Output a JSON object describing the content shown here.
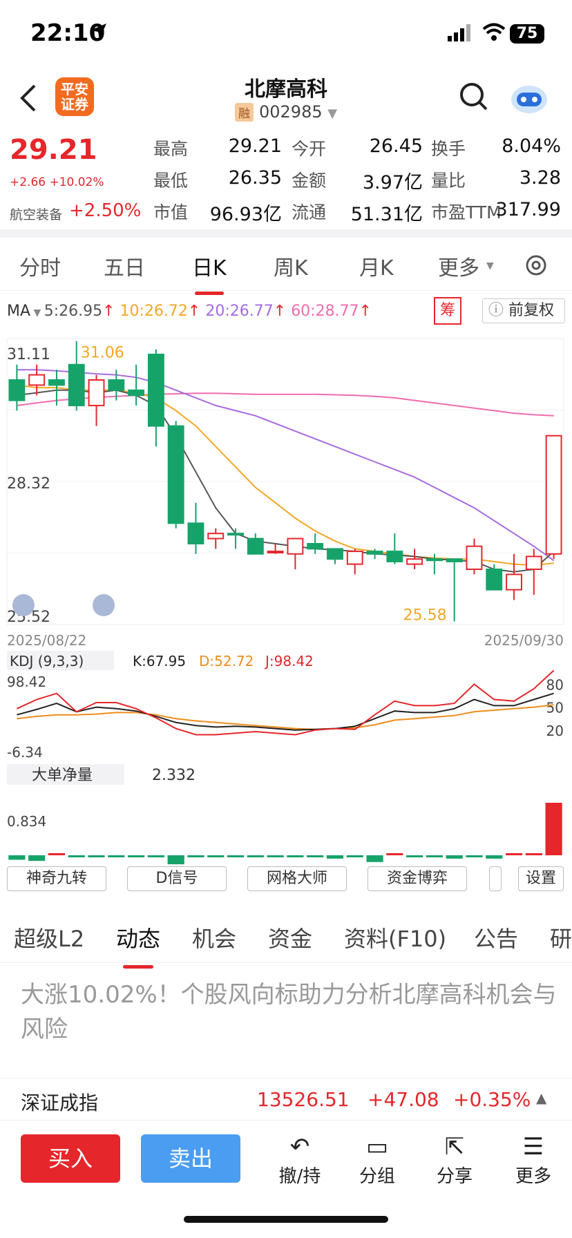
{
  "status": {
    "time": "22:10",
    "battery": "75"
  },
  "header": {
    "name": "北摩高科",
    "code": "002985",
    "rong": "融",
    "logo": "平安\n证券"
  },
  "quote": {
    "price": "29.21",
    "change": "+2.66 +10.02%",
    "sector": "航空装备",
    "sector_change": "+2.50%",
    "items": [
      {
        "label": "最高",
        "value": "29.21",
        "color": "red"
      },
      {
        "label": "今开",
        "value": "26.45",
        "color": "green"
      },
      {
        "label": "换手",
        "value": "8.04%",
        "color": "black"
      },
      {
        "label": "最低",
        "value": "26.35",
        "color": "green"
      },
      {
        "label": "金额",
        "value": "3.97亿",
        "color": "black"
      },
      {
        "label": "量比",
        "value": "3.28",
        "color": "black"
      },
      {
        "label": "市值",
        "value": "96.93亿",
        "color": "black"
      },
      {
        "label": "流通",
        "value": "51.31亿",
        "color": "black"
      },
      {
        "label": "市盈TTM",
        "value": "317.99",
        "color": "black"
      }
    ]
  },
  "periods": [
    "分时",
    "五日",
    "日K",
    "周K",
    "月K",
    "更多"
  ],
  "active_period": "日K",
  "ma": {
    "label": "MA",
    "ma5": "5:26.95",
    "ma10": "10:26.72",
    "ma20": "20:26.77",
    "ma60": "60:28.77",
    "chou": "筹",
    "fq": "前复权"
  },
  "chart_data": {
    "type": "candlestick",
    "y_max_label": "31.11",
    "y_mid_label": "28.32",
    "y_min_label": "25.52",
    "high_label": "31.06",
    "low_label": "25.58",
    "start_date": "2025/08/22",
    "end_date": "2025/09/30",
    "candles": [
      {
        "o": 30.3,
        "c": 29.9,
        "h": 30.6,
        "l": 29.7
      },
      {
        "o": 30.2,
        "c": 30.4,
        "h": 30.6,
        "l": 30.0
      },
      {
        "o": 30.3,
        "c": 30.2,
        "h": 30.5,
        "l": 29.8
      },
      {
        "o": 30.6,
        "c": 29.8,
        "h": 31.06,
        "l": 29.7
      },
      {
        "o": 29.8,
        "c": 30.3,
        "h": 30.4,
        "l": 29.4
      },
      {
        "o": 30.3,
        "c": 30.1,
        "h": 30.5,
        "l": 29.9
      },
      {
        "o": 30.1,
        "c": 30.0,
        "h": 30.6,
        "l": 29.8
      },
      {
        "o": 30.8,
        "c": 29.4,
        "h": 30.9,
        "l": 29.0
      },
      {
        "o": 29.4,
        "c": 27.5,
        "h": 29.5,
        "l": 27.4
      },
      {
        "o": 27.5,
        "c": 27.1,
        "h": 27.9,
        "l": 26.9
      },
      {
        "o": 27.2,
        "c": 27.3,
        "h": 27.4,
        "l": 27.0
      },
      {
        "o": 27.3,
        "c": 27.28,
        "h": 27.4,
        "l": 27.0
      },
      {
        "o": 27.2,
        "c": 26.9,
        "h": 27.3,
        "l": 26.9
      },
      {
        "o": 26.95,
        "c": 26.95,
        "h": 27.1,
        "l": 26.9
      },
      {
        "o": 26.9,
        "c": 27.2,
        "h": 27.2,
        "l": 26.6
      },
      {
        "o": 27.1,
        "c": 27.0,
        "h": 27.3,
        "l": 26.9
      },
      {
        "o": 27.0,
        "c": 26.8,
        "h": 27.0,
        "l": 26.7
      },
      {
        "o": 26.7,
        "c": 26.95,
        "h": 27.0,
        "l": 26.5
      },
      {
        "o": 26.95,
        "c": 26.9,
        "h": 27.0,
        "l": 26.8
      },
      {
        "o": 26.95,
        "c": 26.75,
        "h": 27.3,
        "l": 26.7
      },
      {
        "o": 26.7,
        "c": 26.8,
        "h": 27.0,
        "l": 26.6
      },
      {
        "o": 26.8,
        "c": 26.78,
        "h": 26.9,
        "l": 26.5
      },
      {
        "o": 26.8,
        "c": 26.75,
        "h": 26.8,
        "l": 25.58
      },
      {
        "o": 26.6,
        "c": 27.05,
        "h": 27.2,
        "l": 26.5
      },
      {
        "o": 26.6,
        "c": 26.2,
        "h": 26.7,
        "l": 26.2
      },
      {
        "o": 26.2,
        "c": 26.5,
        "h": 26.9,
        "l": 26.0
      },
      {
        "o": 26.6,
        "c": 26.85,
        "h": 27.0,
        "l": 26.1
      },
      {
        "o": 26.9,
        "c": 29.21,
        "h": 29.21,
        "l": 26.8
      }
    ],
    "ma5": [
      30.0,
      30.05,
      30.1,
      30.1,
      30.05,
      30.1,
      30.0,
      29.8,
      29.2,
      28.5,
      27.8,
      27.3,
      27.15,
      27.1,
      27.05,
      27.0,
      26.98,
      26.95,
      26.9,
      26.88,
      26.85,
      26.8,
      26.78,
      26.75,
      26.6,
      26.55,
      26.6,
      26.95
    ],
    "ma10": [
      30.2,
      30.15,
      30.15,
      30.1,
      30.1,
      30.1,
      30.05,
      29.95,
      29.7,
      29.4,
      29.0,
      28.6,
      28.2,
      27.9,
      27.6,
      27.35,
      27.15,
      27.0,
      26.95,
      26.9,
      26.85,
      26.82,
      26.8,
      26.8,
      26.75,
      26.7,
      26.68,
      26.72
    ],
    "ma20": [
      30.5,
      30.5,
      30.48,
      30.45,
      30.42,
      30.4,
      30.35,
      30.25,
      30.1,
      29.95,
      29.8,
      29.7,
      29.6,
      29.45,
      29.3,
      29.15,
      29.0,
      28.85,
      28.7,
      28.55,
      28.4,
      28.2,
      28.0,
      27.8,
      27.55,
      27.3,
      27.05,
      26.77
    ],
    "ma60": [
      29.8,
      29.85,
      29.9,
      29.93,
      29.96,
      29.98,
      30.0,
      30.02,
      30.03,
      30.04,
      30.04,
      30.03,
      30.02,
      30.02,
      30.02,
      30.02,
      30.01,
      30.0,
      29.98,
      29.95,
      29.9,
      29.85,
      29.8,
      29.75,
      29.7,
      29.65,
      29.62,
      29.6
    ]
  },
  "kdj": {
    "label": "KDJ (9,3,3)",
    "k": "K:67.95",
    "d": "D:52.72",
    "j": "J:98.42",
    "max": "98.42",
    "min": "-6.34",
    "l80": "80",
    "l50": "50",
    "l20": "20",
    "K": [
      40,
      47,
      55,
      44,
      50,
      48,
      45,
      38,
      30,
      26,
      24,
      25,
      24,
      22,
      20,
      21,
      22,
      25,
      35,
      45,
      43,
      43,
      48,
      60,
      52,
      52,
      60,
      68
    ],
    "D": [
      35,
      38,
      40,
      40,
      41,
      43,
      43,
      40,
      35,
      32,
      30,
      28,
      26,
      24,
      22,
      21,
      22,
      23,
      27,
      33,
      35,
      37,
      39,
      44,
      46,
      48,
      50,
      53
    ],
    "J": [
      48,
      60,
      68,
      44,
      56,
      56,
      48,
      36,
      22,
      14,
      14,
      16,
      18,
      16,
      14,
      20,
      22,
      21,
      40,
      58,
      52,
      52,
      55,
      80,
      60,
      58,
      74,
      98
    ]
  },
  "flow": {
    "label": "大单净量",
    "value": "2.332",
    "axis": "0.834",
    "bars": [
      -0.2,
      -0.25,
      0.08,
      -0.05,
      -0.08,
      -0.08,
      -0.08,
      -0.05,
      -0.4,
      -0.05,
      -0.05,
      -0.08,
      -0.05,
      -0.05,
      -0.05,
      -0.05,
      -0.15,
      -0.05,
      -0.3,
      0.05,
      -0.05,
      -0.05,
      -0.15,
      -0.05,
      -0.15,
      0.08,
      0.03,
      2.332
    ]
  },
  "tools": [
    "神奇九转",
    "D信号",
    "网格大师",
    "资金博弈",
    "设置"
  ],
  "subtabs": [
    "超级L2",
    "动态",
    "机会",
    "资金",
    "资料(F10)",
    "公告",
    "研"
  ],
  "news": "大涨10.02%！个股风向标助力分析北摩高科机会与风险",
  "index": {
    "name": "深证成指",
    "value": "13526.51",
    "change": "+47.08",
    "pct": "+0.35%"
  },
  "bottom": {
    "buy": "买入",
    "sell": "卖出",
    "icons": [
      {
        "label": "撤/持",
        "icon": "undo-icon"
      },
      {
        "label": "分组",
        "icon": "folder-icon"
      },
      {
        "label": "分享",
        "icon": "share-icon"
      },
      {
        "label": "更多",
        "icon": "menu-icon"
      }
    ]
  },
  "colors": {
    "up": "#e5262a",
    "down": "#16a36a",
    "ma5": "#555555",
    "ma10": "#f5a623",
    "ma20": "#a66be0",
    "ma60": "#f06bb0"
  }
}
